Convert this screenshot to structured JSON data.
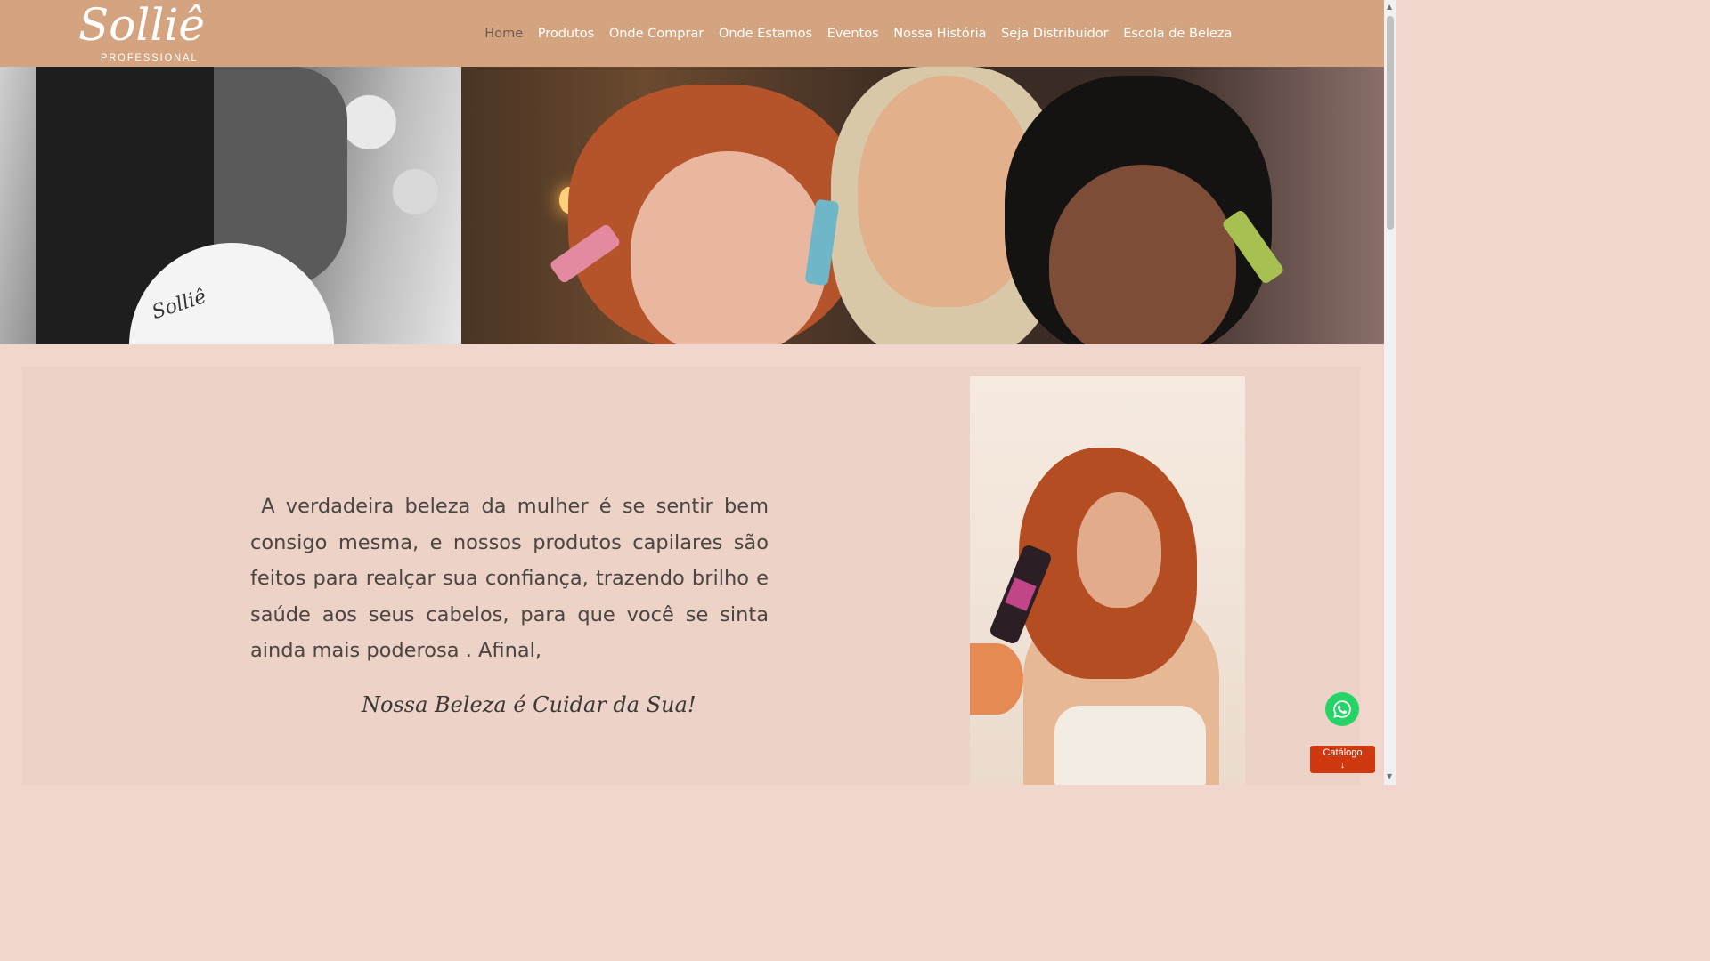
{
  "brand": {
    "name": "Solliê",
    "subtitle": "PROFESSIONAL",
    "background_color": "#d4a37f"
  },
  "nav": {
    "items": [
      {
        "label": "Home",
        "active": true
      },
      {
        "label": "Produtos",
        "active": false
      },
      {
        "label": "Onde Comprar",
        "active": false
      },
      {
        "label": "Onde Estamos",
        "active": false
      },
      {
        "label": "Eventos",
        "active": false
      },
      {
        "label": "Nossa História",
        "active": false
      },
      {
        "label": "Seja Distribuidor",
        "active": false
      },
      {
        "label": "Escola de Beleza",
        "active": false
      }
    ]
  },
  "hero": {
    "dryer_logo": "Solliê"
  },
  "content": {
    "quote": " A verdadeira beleza da mulher é se sentir bem consigo mesma, e nossos produtos capilares são feitos para realçar sua confiança, trazendo brilho e saúde aos seus cabelos, para que você se sinta ainda mais poderosa . Afinal,",
    "tagline": "Nossa Beleza é  Cuidar da Sua!",
    "background_color": "#ecd2c7"
  },
  "floating": {
    "whatsapp_icon": "whatsapp-icon",
    "catalog_label": "Catálogo",
    "catalog_arrow": "↓",
    "catalog_color": "#d0380f"
  },
  "scrollbar": {
    "up_arrow": "▲",
    "down_arrow": "▼"
  }
}
